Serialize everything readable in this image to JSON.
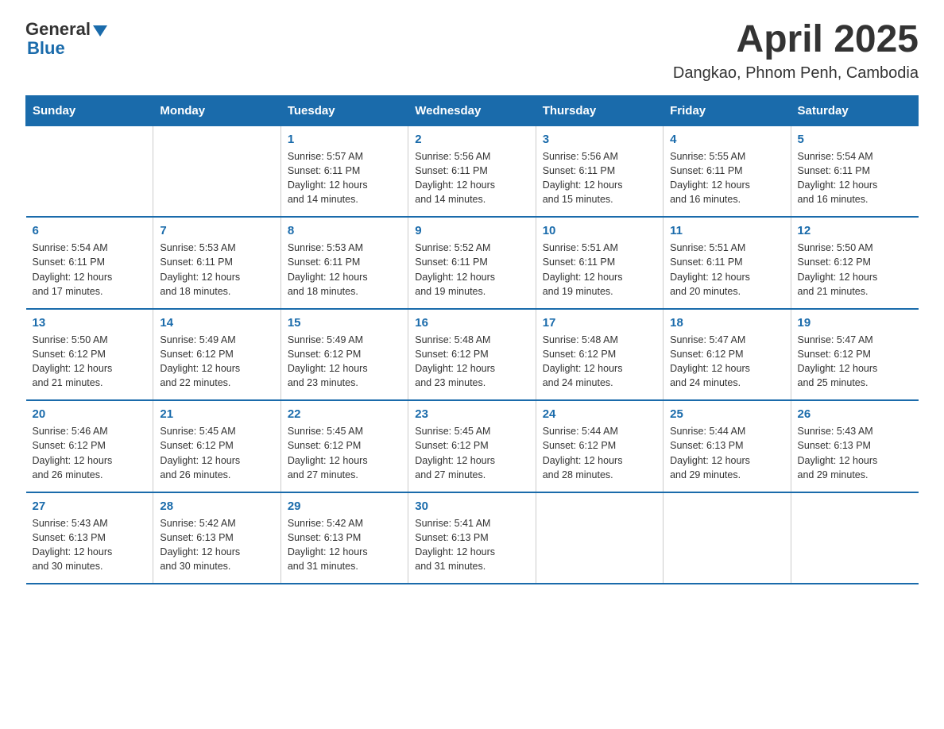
{
  "header": {
    "title": "April 2025",
    "subtitle": "Dangkao, Phnom Penh, Cambodia",
    "logo": {
      "general": "General",
      "arrow": "",
      "blue": "Blue"
    }
  },
  "calendar": {
    "days_of_week": [
      "Sunday",
      "Monday",
      "Tuesday",
      "Wednesday",
      "Thursday",
      "Friday",
      "Saturday"
    ],
    "weeks": [
      [
        {
          "day": "",
          "info": ""
        },
        {
          "day": "",
          "info": ""
        },
        {
          "day": "1",
          "info": "Sunrise: 5:57 AM\nSunset: 6:11 PM\nDaylight: 12 hours\nand 14 minutes."
        },
        {
          "day": "2",
          "info": "Sunrise: 5:56 AM\nSunset: 6:11 PM\nDaylight: 12 hours\nand 14 minutes."
        },
        {
          "day": "3",
          "info": "Sunrise: 5:56 AM\nSunset: 6:11 PM\nDaylight: 12 hours\nand 15 minutes."
        },
        {
          "day": "4",
          "info": "Sunrise: 5:55 AM\nSunset: 6:11 PM\nDaylight: 12 hours\nand 16 minutes."
        },
        {
          "day": "5",
          "info": "Sunrise: 5:54 AM\nSunset: 6:11 PM\nDaylight: 12 hours\nand 16 minutes."
        }
      ],
      [
        {
          "day": "6",
          "info": "Sunrise: 5:54 AM\nSunset: 6:11 PM\nDaylight: 12 hours\nand 17 minutes."
        },
        {
          "day": "7",
          "info": "Sunrise: 5:53 AM\nSunset: 6:11 PM\nDaylight: 12 hours\nand 18 minutes."
        },
        {
          "day": "8",
          "info": "Sunrise: 5:53 AM\nSunset: 6:11 PM\nDaylight: 12 hours\nand 18 minutes."
        },
        {
          "day": "9",
          "info": "Sunrise: 5:52 AM\nSunset: 6:11 PM\nDaylight: 12 hours\nand 19 minutes."
        },
        {
          "day": "10",
          "info": "Sunrise: 5:51 AM\nSunset: 6:11 PM\nDaylight: 12 hours\nand 19 minutes."
        },
        {
          "day": "11",
          "info": "Sunrise: 5:51 AM\nSunset: 6:11 PM\nDaylight: 12 hours\nand 20 minutes."
        },
        {
          "day": "12",
          "info": "Sunrise: 5:50 AM\nSunset: 6:12 PM\nDaylight: 12 hours\nand 21 minutes."
        }
      ],
      [
        {
          "day": "13",
          "info": "Sunrise: 5:50 AM\nSunset: 6:12 PM\nDaylight: 12 hours\nand 21 minutes."
        },
        {
          "day": "14",
          "info": "Sunrise: 5:49 AM\nSunset: 6:12 PM\nDaylight: 12 hours\nand 22 minutes."
        },
        {
          "day": "15",
          "info": "Sunrise: 5:49 AM\nSunset: 6:12 PM\nDaylight: 12 hours\nand 23 minutes."
        },
        {
          "day": "16",
          "info": "Sunrise: 5:48 AM\nSunset: 6:12 PM\nDaylight: 12 hours\nand 23 minutes."
        },
        {
          "day": "17",
          "info": "Sunrise: 5:48 AM\nSunset: 6:12 PM\nDaylight: 12 hours\nand 24 minutes."
        },
        {
          "day": "18",
          "info": "Sunrise: 5:47 AM\nSunset: 6:12 PM\nDaylight: 12 hours\nand 24 minutes."
        },
        {
          "day": "19",
          "info": "Sunrise: 5:47 AM\nSunset: 6:12 PM\nDaylight: 12 hours\nand 25 minutes."
        }
      ],
      [
        {
          "day": "20",
          "info": "Sunrise: 5:46 AM\nSunset: 6:12 PM\nDaylight: 12 hours\nand 26 minutes."
        },
        {
          "day": "21",
          "info": "Sunrise: 5:45 AM\nSunset: 6:12 PM\nDaylight: 12 hours\nand 26 minutes."
        },
        {
          "day": "22",
          "info": "Sunrise: 5:45 AM\nSunset: 6:12 PM\nDaylight: 12 hours\nand 27 minutes."
        },
        {
          "day": "23",
          "info": "Sunrise: 5:45 AM\nSunset: 6:12 PM\nDaylight: 12 hours\nand 27 minutes."
        },
        {
          "day": "24",
          "info": "Sunrise: 5:44 AM\nSunset: 6:12 PM\nDaylight: 12 hours\nand 28 minutes."
        },
        {
          "day": "25",
          "info": "Sunrise: 5:44 AM\nSunset: 6:13 PM\nDaylight: 12 hours\nand 29 minutes."
        },
        {
          "day": "26",
          "info": "Sunrise: 5:43 AM\nSunset: 6:13 PM\nDaylight: 12 hours\nand 29 minutes."
        }
      ],
      [
        {
          "day": "27",
          "info": "Sunrise: 5:43 AM\nSunset: 6:13 PM\nDaylight: 12 hours\nand 30 minutes."
        },
        {
          "day": "28",
          "info": "Sunrise: 5:42 AM\nSunset: 6:13 PM\nDaylight: 12 hours\nand 30 minutes."
        },
        {
          "day": "29",
          "info": "Sunrise: 5:42 AM\nSunset: 6:13 PM\nDaylight: 12 hours\nand 31 minutes."
        },
        {
          "day": "30",
          "info": "Sunrise: 5:41 AM\nSunset: 6:13 PM\nDaylight: 12 hours\nand 31 minutes."
        },
        {
          "day": "",
          "info": ""
        },
        {
          "day": "",
          "info": ""
        },
        {
          "day": "",
          "info": ""
        }
      ]
    ]
  }
}
